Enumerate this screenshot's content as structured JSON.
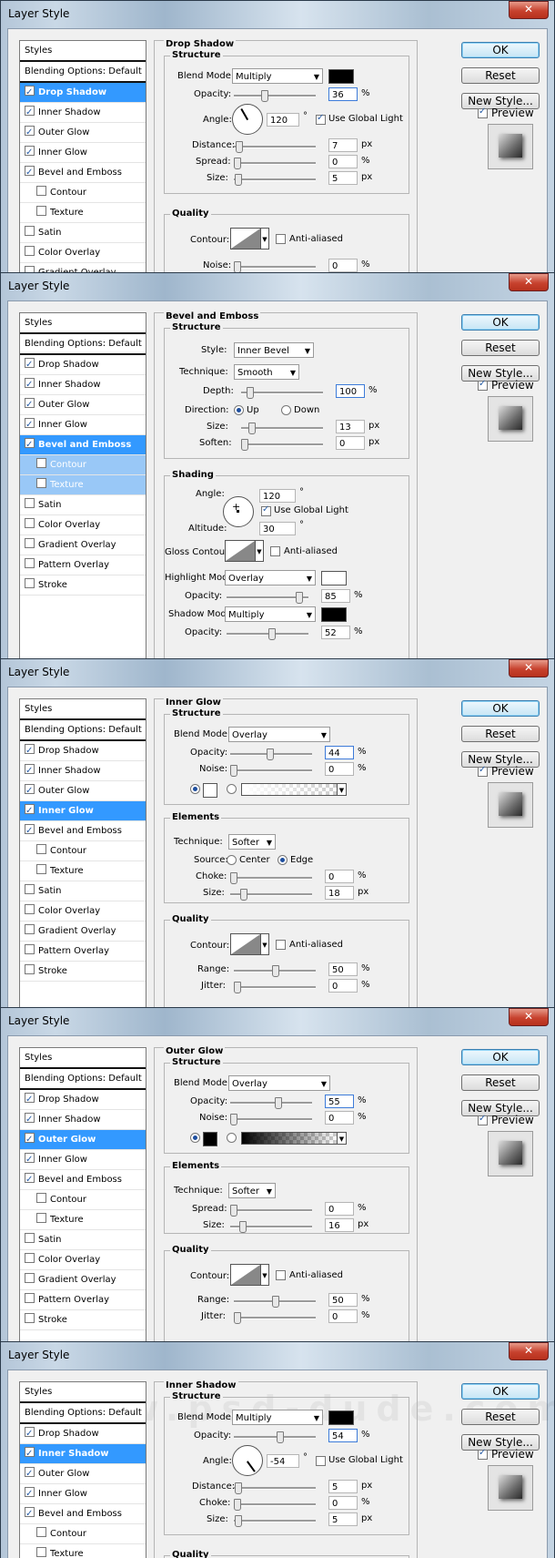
{
  "dialog_title": "Layer Style",
  "close_glyph": "✕",
  "buttons": {
    "ok": "OK",
    "reset": "Reset",
    "new_style": "New Style...",
    "preview": "Preview"
  },
  "styles_list": {
    "header": "Styles",
    "blending": "Blending Options: Default",
    "d1": [
      {
        "label": "Drop Shadow",
        "checked": true
      },
      {
        "label": "Inner Shadow",
        "checked": true
      },
      {
        "label": "Outer Glow",
        "checked": true
      },
      {
        "label": "Inner Glow",
        "checked": true
      },
      {
        "label": "Bevel and Emboss",
        "checked": true
      },
      {
        "label": "Contour",
        "checked": false
      },
      {
        "label": "Texture",
        "checked": false
      },
      {
        "label": "Satin",
        "checked": false
      },
      {
        "label": "Color Overlay",
        "checked": false
      },
      {
        "label": "Gradient Overlay",
        "checked": false
      }
    ],
    "d2": [
      {
        "label": "Drop Shadow",
        "checked": true
      },
      {
        "label": "Inner Shadow",
        "checked": true
      },
      {
        "label": "Outer Glow",
        "checked": true
      },
      {
        "label": "Inner Glow",
        "checked": true
      },
      {
        "label": "Bevel and Emboss",
        "checked": true
      },
      {
        "label": "Contour",
        "checked": false
      },
      {
        "label": "Texture",
        "checked": false
      },
      {
        "label": "Satin",
        "checked": false
      },
      {
        "label": "Color Overlay",
        "checked": false
      },
      {
        "label": "Gradient Overlay",
        "checked": false
      },
      {
        "label": "Pattern Overlay",
        "checked": false
      },
      {
        "label": "Stroke",
        "checked": false
      }
    ],
    "d5": [
      {
        "label": "Drop Shadow",
        "checked": true
      },
      {
        "label": "Inner Shadow",
        "checked": true
      },
      {
        "label": "Outer Glow",
        "checked": true
      },
      {
        "label": "Inner Glow",
        "checked": true
      },
      {
        "label": "Bevel and Emboss",
        "checked": true
      },
      {
        "label": "Contour",
        "checked": false
      },
      {
        "label": "Texture",
        "checked": false
      }
    ]
  },
  "drop_shadow": {
    "title": "Drop Shadow",
    "structure": "Structure",
    "blend_mode_label": "Blend Mode:",
    "blend_mode": "Multiply",
    "color": "#000000",
    "opacity_label": "Opacity:",
    "opacity": "36",
    "angle_label": "Angle:",
    "angle": "120",
    "global_light": "Use Global Light",
    "distance_label": "Distance:",
    "distance": "7",
    "spread_label": "Spread:",
    "spread": "0",
    "size_label": "Size:",
    "size": "5",
    "quality": "Quality",
    "contour_label": "Contour:",
    "anti_aliased": "Anti-aliased",
    "noise_label": "Noise:",
    "noise": "0"
  },
  "bevel": {
    "title": "Bevel and Emboss",
    "structure": "Structure",
    "style_label": "Style:",
    "style": "Inner Bevel",
    "technique_label": "Technique:",
    "technique": "Smooth",
    "depth_label": "Depth:",
    "depth": "100",
    "direction_label": "Direction:",
    "up": "Up",
    "down": "Down",
    "size_label": "Size:",
    "size": "13",
    "soften_label": "Soften:",
    "soften": "0",
    "shading": "Shading",
    "angle_label": "Angle:",
    "angle": "120",
    "global_light": "Use Global Light",
    "altitude_label": "Altitude:",
    "altitude": "30",
    "gloss_label": "Gloss Contour:",
    "anti_aliased": "Anti-aliased",
    "highlight_label": "Highlight Mode:",
    "highlight_mode": "Overlay",
    "highlight_color": "#ffffff",
    "h_opacity": "85",
    "shadow_label": "Shadow Mode:",
    "shadow_mode": "Multiply",
    "shadow_color": "#000000",
    "s_opacity": "52",
    "opacity_label": "Opacity:"
  },
  "inner_glow": {
    "title": "Inner Glow",
    "structure": "Structure",
    "blend_mode_label": "Blend Mode:",
    "blend_mode": "Overlay",
    "opacity_label": "Opacity:",
    "opacity": "44",
    "noise_label": "Noise:",
    "noise": "0",
    "elements": "Elements",
    "technique_label": "Technique:",
    "technique": "Softer",
    "source_label": "Source:",
    "center": "Center",
    "edge": "Edge",
    "choke_label": "Choke:",
    "choke": "0",
    "size_label": "Size:",
    "size": "18",
    "quality": "Quality",
    "contour_label": "Contour:",
    "anti_aliased": "Anti-aliased",
    "range_label": "Range:",
    "range": "50",
    "jitter_label": "Jitter:",
    "jitter": "0"
  },
  "outer_glow": {
    "title": "Outer Glow",
    "structure": "Structure",
    "blend_mode_label": "Blend Mode:",
    "blend_mode": "Overlay",
    "opacity_label": "Opacity:",
    "opacity": "55",
    "noise_label": "Noise:",
    "noise": "0",
    "elements": "Elements",
    "technique_label": "Technique:",
    "technique": "Softer",
    "spread_label": "Spread:",
    "spread": "0",
    "size_label": "Size:",
    "size": "16",
    "quality": "Quality",
    "contour_label": "Contour:",
    "anti_aliased": "Anti-aliased",
    "range_label": "Range:",
    "range": "50",
    "jitter_label": "Jitter:",
    "jitter": "0"
  },
  "inner_shadow": {
    "title": "Inner Shadow",
    "structure": "Structure",
    "blend_mode_label": "Blend Mode:",
    "blend_mode": "Multiply",
    "color": "#000000",
    "opacity_label": "Opacity:",
    "opacity": "54",
    "angle_label": "Angle:",
    "angle": "-54",
    "global_light": "Use Global Light",
    "distance_label": "Distance:",
    "distance": "5",
    "choke_label": "Choke:",
    "choke": "0",
    "size_label": "Size:",
    "size": "5",
    "quality": "Quality"
  },
  "units": {
    "pct": "%",
    "px": "px",
    "deg": "°"
  },
  "watermark": "www.psd-dude.com"
}
